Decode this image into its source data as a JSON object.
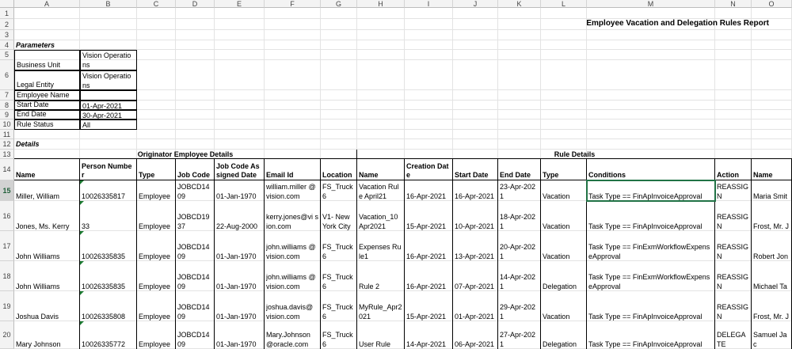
{
  "columns": [
    "A",
    "B",
    "C",
    "D",
    "E",
    "F",
    "G",
    "H",
    "I",
    "J",
    "K",
    "L",
    "M",
    "N",
    "O"
  ],
  "rows": [
    "1",
    "2",
    "3",
    "4",
    "5",
    "6",
    "7",
    "8",
    "9",
    "10",
    "11",
    "12",
    "13",
    "14",
    "15",
    "16",
    "17",
    "18",
    "19",
    "20"
  ],
  "report_title": "Employee Vacation and Delegation Rules Report",
  "parameters": {
    "heading": "Parameters",
    "items": [
      {
        "label": "Business Unit",
        "value": "Vision Operations"
      },
      {
        "label": "Legal Entity",
        "value": "Vision Operations"
      },
      {
        "label": "Employee Name",
        "value": ""
      },
      {
        "label": "Start Date",
        "value": "01-Apr-2021"
      },
      {
        "label": "End Date",
        "value": "30-Apr-2021"
      },
      {
        "label": "Rule Status",
        "value": "All"
      }
    ]
  },
  "details_heading": "Details",
  "group_headers": {
    "originator": "Originator Employee Details",
    "rule": "Rule Details"
  },
  "table_headers": [
    "Name",
    "Person Number",
    "Type",
    "Job Code",
    "Job Code Assigned Date",
    "Email Id",
    "Location",
    "Name",
    "Creation Date",
    "Start Date",
    "End Date",
    "Type",
    "Conditions",
    "Action",
    "Name"
  ],
  "table_rows": [
    [
      "Miller, William",
      "10026335817",
      "Employee",
      "JOBCD1409",
      "01-Jan-1970",
      "william.miller @vision.com",
      "FS_Truck6",
      "Vacation Rule April21",
      "16-Apr-2021",
      "16-Apr-2021",
      "23-Apr-2021",
      "Vacation",
      "Task Type == FinApInvoiceApproval",
      "REASSIGN",
      "Maria Smit"
    ],
    [
      "Jones, Ms. Kerry",
      "33",
      "Employee",
      "JOBCD1937",
      "22-Aug-2000",
      "kerry.jones@vi sion.com",
      "V1- New York City",
      "Vacation_10 Apr2021",
      "15-Apr-2021",
      "10-Apr-2021",
      "18-Apr-2021",
      "Vacation",
      "Task Type == FinApInvoiceApproval",
      "REASSIGN",
      "Frost, Mr. J"
    ],
    [
      "John Williams",
      "10026335835",
      "Employee",
      "JOBCD1409",
      "01-Jan-1970",
      "john.williams @vision.com",
      "FS_Truck6",
      "Expenses Rule1",
      "16-Apr-2021",
      "13-Apr-2021",
      "20-Apr-2021",
      "Vacation",
      "Task Type == FinExmWorkflowExpenseApproval",
      "REASSIGN",
      "Robert Jon"
    ],
    [
      "John Williams",
      "10026335835",
      "Employee",
      "JOBCD1409",
      "01-Jan-1970",
      "john.williams @vision.com",
      "FS_Truck6",
      "Rule 2",
      "16-Apr-2021",
      "07-Apr-2021",
      "14-Apr-2021",
      "Delegation",
      "Task Type == FinExmWorkflowExpenseApproval",
      "REASSIGN",
      "Michael Ta"
    ],
    [
      "Joshua Davis",
      "10026335808",
      "Employee",
      "JOBCD1409",
      "01-Jan-1970",
      "joshua.davis@ vision.com",
      "FS_Truck6",
      "MyRule_Apr2 021",
      "15-Apr-2021",
      "01-Apr-2021",
      "29-Apr-2021",
      "Vacation",
      "Task Type == FinApInvoiceApproval",
      "REASSIGN",
      "Frost, Mr. J"
    ],
    [
      "Mary Johnson",
      "10026335772",
      "Employee",
      "JOBCD1409",
      "01-Jan-1970",
      "Mary.Johnson @oracle.com",
      "FS_Truck6",
      "User Rule",
      "14-Apr-2021",
      "06-Apr-2021",
      "27-Apr-2021",
      "Delegation",
      "Task Type == FinApInvoiceApproval",
      "DELEGATE",
      "Samuel Jac"
    ]
  ]
}
